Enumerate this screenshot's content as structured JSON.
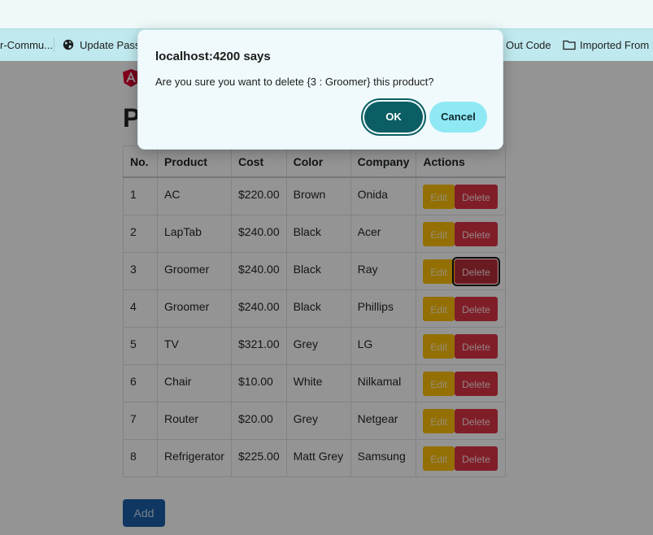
{
  "bookmarks": [
    {
      "label": "r-Commu...",
      "icon": "none"
    },
    {
      "label": "Update Passw",
      "icon": "globe-icon"
    },
    {
      "label": "Out Code",
      "icon": "none"
    },
    {
      "label": "Imported From F",
      "icon": "folder-icon"
    }
  ],
  "page": {
    "title": "P",
    "table": {
      "headers": [
        "No.",
        "Product",
        "Cost",
        "Color",
        "Company",
        "Actions"
      ],
      "rows": [
        {
          "no": "1",
          "product": "AC",
          "cost": "$220.00",
          "color": "Brown",
          "company": "Onida"
        },
        {
          "no": "2",
          "product": "LapTab",
          "cost": "$240.00",
          "color": "Black",
          "company": "Acer"
        },
        {
          "no": "3",
          "product": "Groomer",
          "cost": "$240.00",
          "color": "Black",
          "company": "Ray"
        },
        {
          "no": "4",
          "product": "Groomer",
          "cost": "$240.00",
          "color": "Black",
          "company": "Phillips"
        },
        {
          "no": "5",
          "product": "TV",
          "cost": "$321.00",
          "color": "Grey",
          "company": "LG"
        },
        {
          "no": "6",
          "product": "Chair",
          "cost": "$10.00",
          "color": "White",
          "company": "Nilkamal"
        },
        {
          "no": "7",
          "product": "Router",
          "cost": "$20.00",
          "color": "Grey",
          "company": "Netgear"
        },
        {
          "no": "8",
          "product": "Refrigerator",
          "cost": "$225.00",
          "color": "Matt Grey",
          "company": "Samsung"
        }
      ],
      "edit_label": "Edit",
      "delete_label": "Delete"
    },
    "add_label": "Add"
  },
  "dialog": {
    "title": "localhost:4200 says",
    "message": "Are you sure you want to delete {3 : Groomer} this product?",
    "ok_label": "OK",
    "cancel_label": "Cancel"
  },
  "colors": {
    "dialog_ok": "#0b5e63",
    "dialog_cancel": "#8fe9f5",
    "edit": "#ffc107",
    "delete": "#dc3545",
    "add": "#0d6efd"
  }
}
